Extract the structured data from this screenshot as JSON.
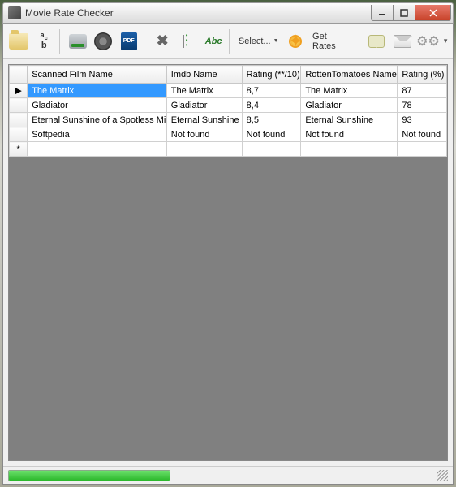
{
  "window": {
    "title": "Movie Rate Checker"
  },
  "toolbar": {
    "pdf_label": "PDF",
    "select_label": "Select...",
    "getrates_label": "Get Rates"
  },
  "grid": {
    "headers": {
      "scanned": "Scanned Film Name",
      "imdb": "Imdb Name",
      "rating10": "Rating (**/10)",
      "rt": "RottenTomatoes Name",
      "ratingpct": "Rating (%)"
    },
    "rows": [
      {
        "scanned": "The Matrix",
        "imdb": "The Matrix",
        "rating10": "8,7",
        "rt": "The Matrix",
        "ratingpct": "87"
      },
      {
        "scanned": "Gladiator",
        "imdb": "Gladiator",
        "rating10": "8,4",
        "rt": "Gladiator",
        "ratingpct": "78"
      },
      {
        "scanned": "Eternal Sunshine of a Spotless Mind",
        "imdb": "Eternal Sunshine",
        "rating10": "8,5",
        "rt": "Eternal Sunshine",
        "ratingpct": "93"
      },
      {
        "scanned": "Softpedia",
        "imdb": "Not found",
        "rating10": "Not found",
        "rt": "Not found",
        "ratingpct": "Not found"
      }
    ],
    "row_indicator": "▶",
    "new_row_indicator": "*"
  }
}
